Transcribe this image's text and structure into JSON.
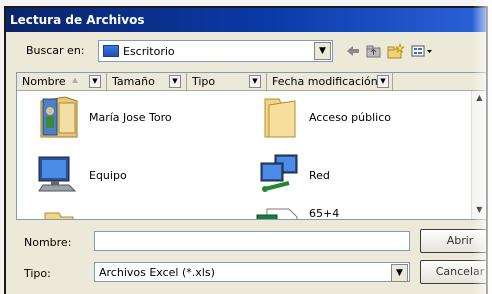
{
  "window": {
    "title": "Lectura de Archivos"
  },
  "toolbar": {
    "look_in_label": "Buscar en:",
    "look_in_value": "Escritorio",
    "icons": [
      "back-arrow-icon",
      "up-folder-icon",
      "new-folder-icon",
      "view-menu-icon"
    ]
  },
  "columns": [
    {
      "label": "Nombre"
    },
    {
      "label": "Tamaño"
    },
    {
      "label": "Tipo"
    },
    {
      "label": "Fecha modificación"
    }
  ],
  "items": [
    {
      "label": "María Jose Toro",
      "icon": "user-folder-icon"
    },
    {
      "label": "Acceso público",
      "icon": "folder-icon"
    },
    {
      "label": "Equipo",
      "icon": "computer-icon"
    },
    {
      "label": "Red",
      "icon": "network-icon"
    },
    {
      "label": "",
      "icon": "folder-icon"
    },
    {
      "label": "65+4",
      "icon": "excel-file-icon"
    }
  ],
  "form": {
    "name_label": "Nombre:",
    "name_value": "",
    "type_label": "Tipo:",
    "type_value": "Archivos Excel (*.xls)"
  },
  "buttons": {
    "open": "Abrir",
    "cancel": "Cancelar"
  },
  "colors": {
    "titlebar": "#0a246a",
    "accent": "#2b63d8"
  }
}
